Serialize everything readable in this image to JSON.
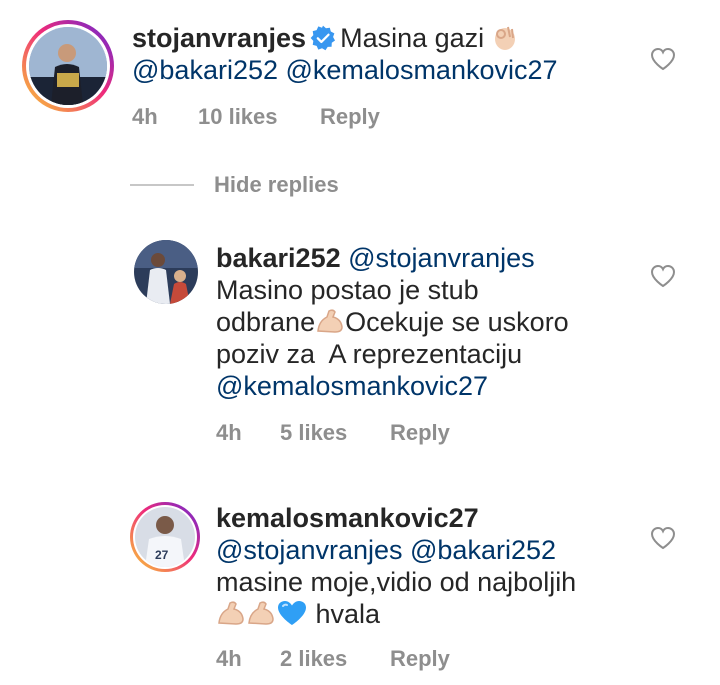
{
  "comments": [
    {
      "username": "stojanvranjes",
      "verified": true,
      "text_before": "Masina gazi",
      "emoji": "ok-hand-emoji",
      "mentions_line": "@bakari252 @kemalosmankovic27",
      "time": "4h",
      "likes": "10 likes",
      "reply": "Reply"
    }
  ],
  "hide_replies": "Hide replies",
  "replies": [
    {
      "username": "bakari252",
      "mention": "@stojanvranjes",
      "line2": "Masino postao je stub",
      "line3_a": "odbrane",
      "line3_b": "Ocekuje se uskoro",
      "line4": "poziv za  A reprezentaciju",
      "line5": "@kemalosmankovic27",
      "time": "4h",
      "likes": "5 likes",
      "reply": "Reply"
    },
    {
      "username": "kemalosmankovic27",
      "mentions": "@stojanvranjes @bakari252",
      "line3": "masine moje,vidio od najboljih",
      "line4_text": "hvala",
      "time": "4h",
      "likes": "2 likes",
      "reply": "Reply"
    }
  ],
  "colors": {
    "username": "#262626",
    "mention": "#003569",
    "meta": "#8e8e8e",
    "verified": "#3897f0",
    "heart_outline": "#8e8e8e"
  }
}
